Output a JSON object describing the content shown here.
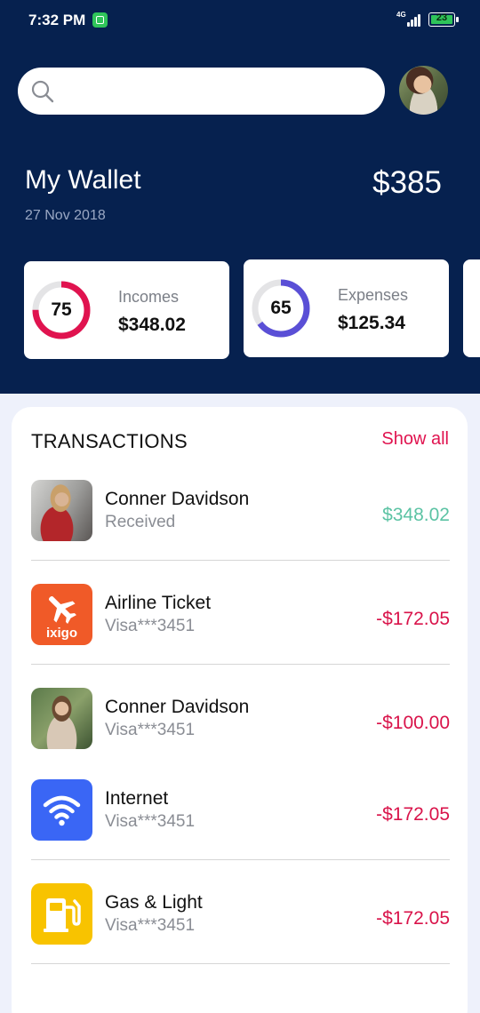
{
  "status": {
    "time": "7:32 PM",
    "network": "4G",
    "battery": "23"
  },
  "search": {
    "placeholder": ""
  },
  "wallet": {
    "title": "My Wallet",
    "date": "27 Nov 2018",
    "balance": "$385"
  },
  "cards": [
    {
      "label": "Incomes",
      "amount": "$348.02",
      "ring_value": "75",
      "ring_percent": 75,
      "ring_color": "#e0134f"
    },
    {
      "label": "Expenses",
      "amount": "$125.34",
      "ring_value": "65",
      "ring_percent": 65,
      "ring_color": "#5a4fd6"
    }
  ],
  "transactions": {
    "title": "TRANSACTIONS",
    "show_all": "Show all",
    "items": [
      {
        "name": "Conner Davidson",
        "subtitle": "Received",
        "amount": "$348.02",
        "icon": "person-photo"
      },
      {
        "name": "Airline Ticket",
        "subtitle": "Visa***3451",
        "amount": "-$172.05",
        "icon": "ixigo-airplane-icon",
        "icon_text": "ixigo"
      },
      {
        "name": "Conner Davidson",
        "subtitle": "Visa***3451",
        "amount": "-$100.00",
        "icon": "person-photo"
      },
      {
        "name": "Internet",
        "subtitle": "Visa***3451",
        "amount": "-$172.05",
        "icon": "wifi-icon"
      },
      {
        "name": "Gas & Light",
        "subtitle": "Visa***3451",
        "amount": "-$172.05",
        "icon": "gas-pump-icon"
      }
    ]
  },
  "colors": {
    "header_bg": "#06214f",
    "accent": "#e0134f",
    "positive": "#5cc3a4",
    "negative": "#d9134a"
  }
}
